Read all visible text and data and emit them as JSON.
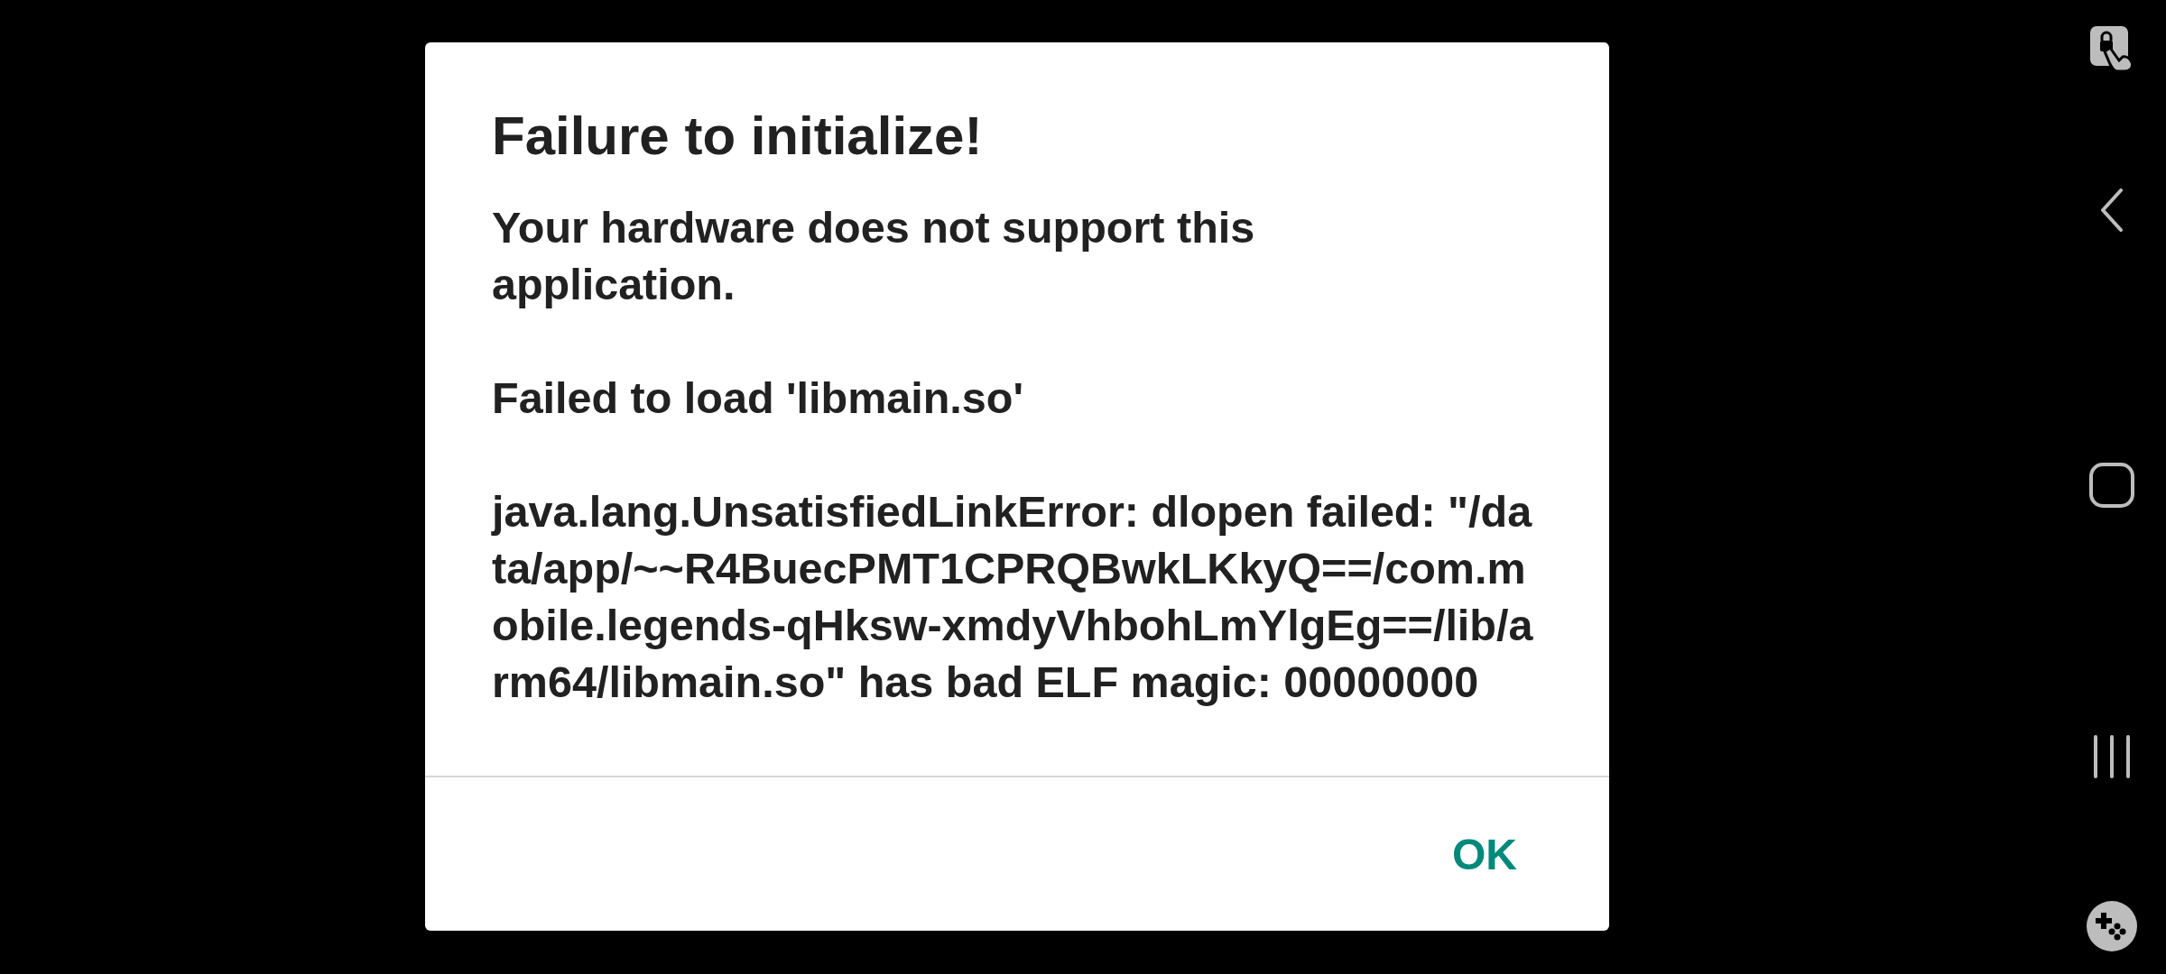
{
  "dialog": {
    "title": "Failure to initialize!",
    "paragraphs": [
      "Your hardware does not support this application.",
      "Failed to load 'libmain.so'",
      "java.lang.UnsatisfiedLinkError: dlopen failed: \"/data/app/~~R4BuecPMT1CPRQBwkLKkyQ==/com.mobile.legends-qHksw-xmdyVhbohLmYlgEg==/lib/arm64/libmain.so\" has bad ELF magic: 00000000"
    ],
    "buttons": [
      "OK"
    ]
  }
}
